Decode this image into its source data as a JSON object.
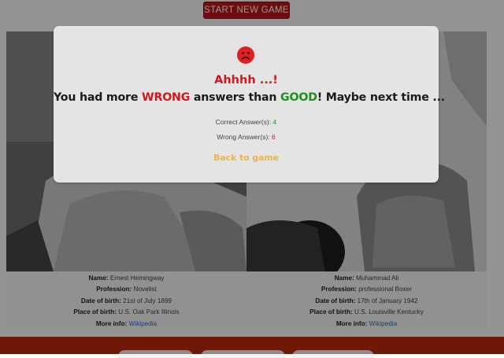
{
  "header": {
    "start_button_label": "START NEW GAME"
  },
  "cards": [
    {
      "name_label": "Name:",
      "name": "Ernest Hemingway",
      "profession_label": "Profession:",
      "profession": "Novelist",
      "dob_label": "Date of birth:",
      "dob": "21st of July 1899",
      "pob_label": "Place of birth:",
      "pob": "U.S. Oak Park Illinois",
      "more_label": "More info:",
      "more_link": "Wikipedia"
    },
    {
      "name_label": "Name:",
      "name": "Muhammad Ali",
      "profession_label": "Profession:",
      "profession": "professional Boxer",
      "dob_label": "Date of birth:",
      "dob": "17th of January 1942",
      "pob_label": "Place of birth:",
      "pob": "U.S. Louisville Kentucky",
      "more_label": "More info:",
      "more_link": "Wikipedia"
    }
  ],
  "modal": {
    "icon": "sad-face-icon",
    "exclaim": "Ahhhh ...!",
    "headline_pre": "You had more ",
    "headline_wrong": "WRONG",
    "headline_mid": " answers than ",
    "headline_good": "GOOD",
    "headline_post": "! Maybe next time ...",
    "correct_label": "Correct Answer(s):",
    "correct_count": "4",
    "wrong_label": "Wrong Answer(s):",
    "wrong_count": "6",
    "back_label": "Back to game"
  },
  "colors": {
    "accent_red": "#d6161a",
    "accent_green": "#1f8f1f",
    "back_link": "#e7b54e",
    "footer_bg": "#c02a0d",
    "start_button_bg": "#c0191c"
  }
}
